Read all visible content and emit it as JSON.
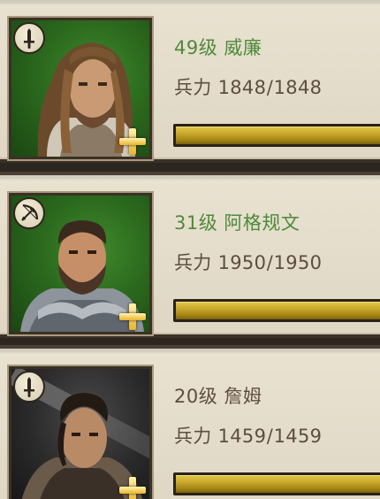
{
  "colors": {
    "name_green": "#4e8a3a",
    "name_brown": "#5d4e3d",
    "troops_text": "#5d4e3d",
    "bar_gold": "#c9a82b",
    "card_bg": "#e4dccb"
  },
  "heroes": [
    {
      "level": "49级",
      "name": "威廉",
      "troops_label": "兵力",
      "troops_current": "1848",
      "troops_max": "1848",
      "troops_fraction": 1.0,
      "class_icon": "sword-icon",
      "name_color": "#4e8a3a",
      "portrait": "long-haired-warrior-portrait"
    },
    {
      "level": "31级",
      "name": "阿格规文",
      "troops_label": "兵力",
      "troops_current": "1950",
      "troops_max": "1950",
      "troops_fraction": 1.0,
      "class_icon": "bow-icon",
      "name_color": "#4e8a3a",
      "portrait": "bearded-knight-portrait"
    },
    {
      "level": "20级",
      "name": "詹姆",
      "troops_label": "兵力",
      "troops_current": "1459",
      "troops_max": "1459",
      "troops_fraction": 1.0,
      "class_icon": "sword-icon",
      "name_color": "#5d4e3d",
      "portrait": "dark-haired-swordsman-portrait"
    }
  ]
}
